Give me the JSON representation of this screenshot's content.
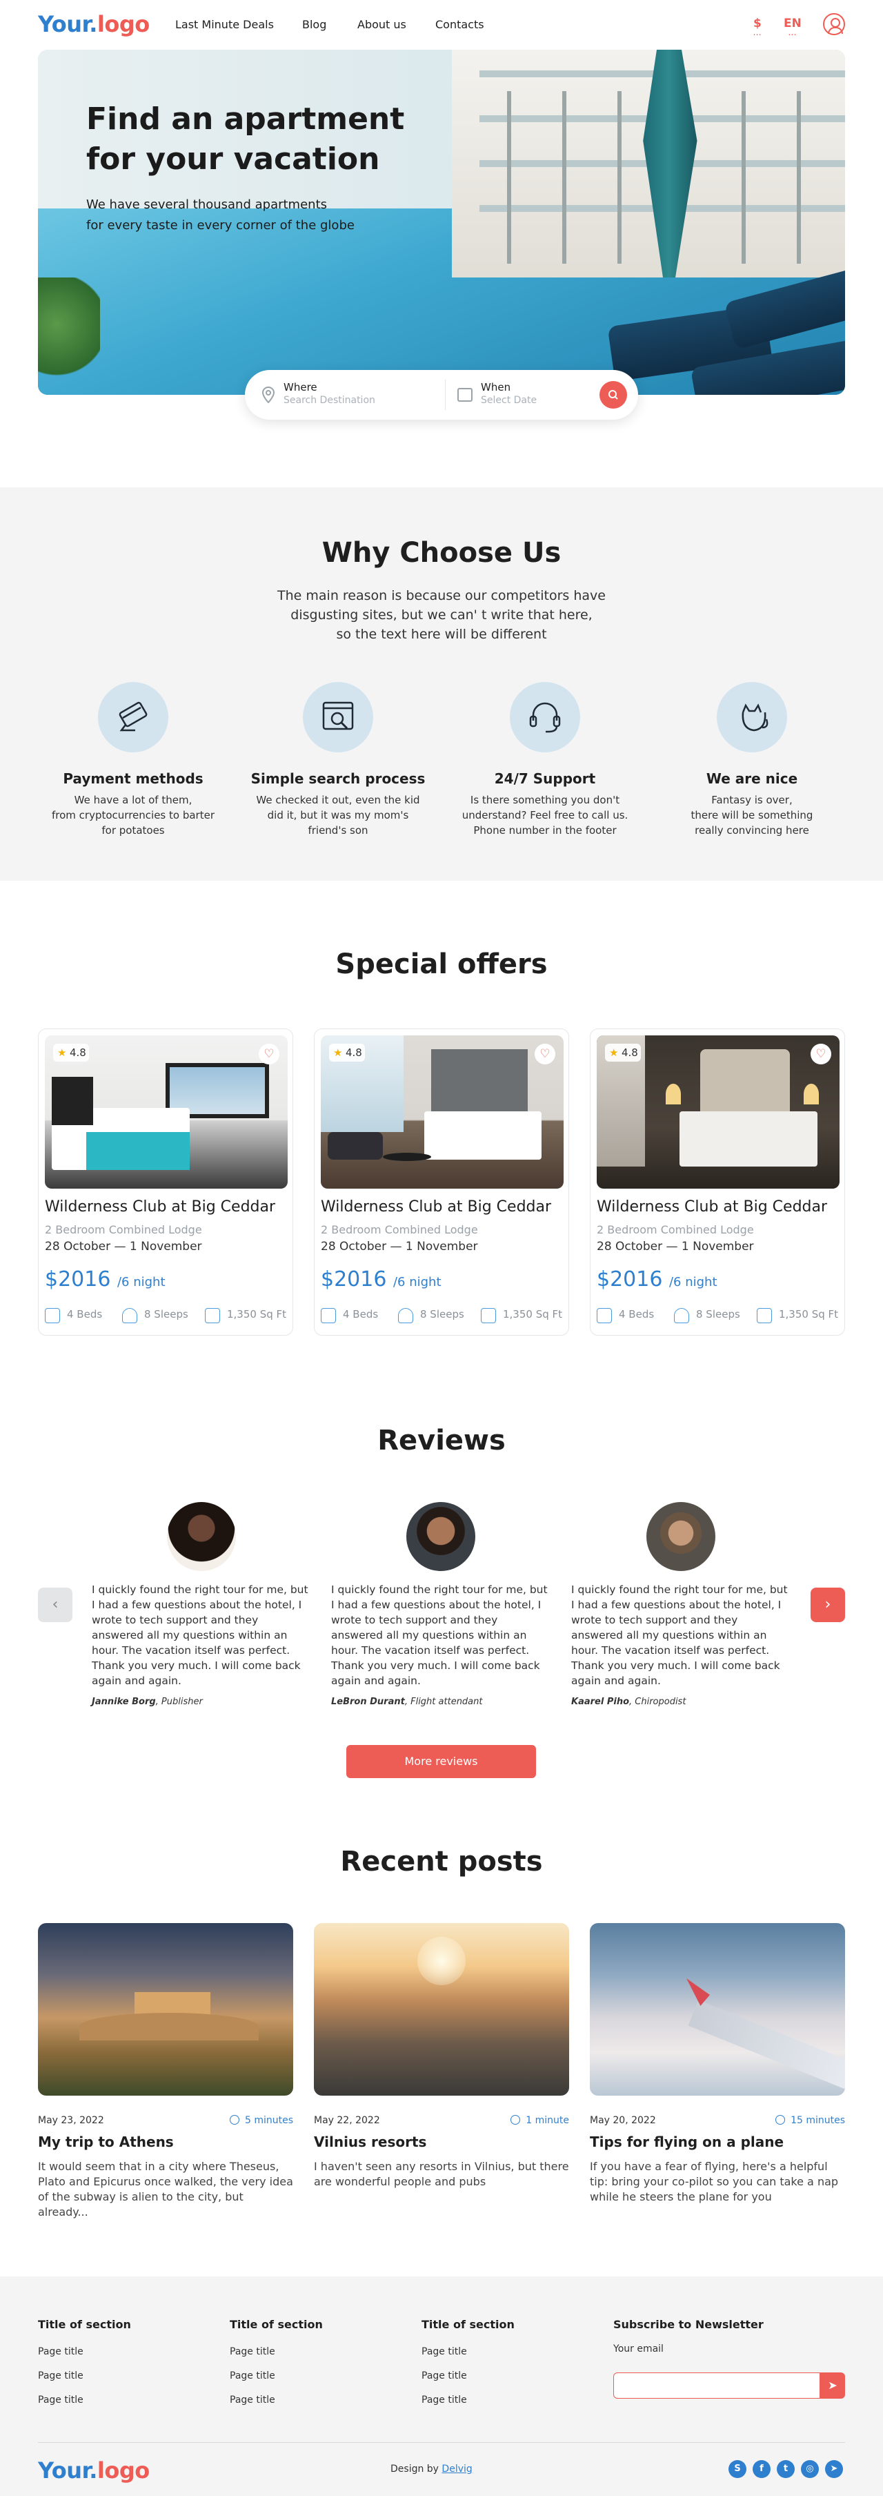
{
  "header": {
    "logo_left": "Your.",
    "logo_right": "logo",
    "nav": [
      "Last Minute Deals",
      "Blog",
      "About us",
      "Contacts"
    ],
    "currency": "$",
    "language": "EN"
  },
  "hero": {
    "title_line1": "Find an apartment",
    "title_line2": "for your vacation",
    "subtitle_line1": "We have several thousand apartments",
    "subtitle_line2": "for every taste in every corner of the globe"
  },
  "search": {
    "where_label": "Where",
    "where_placeholder": "Search Destination",
    "when_label": "When",
    "when_placeholder": "Select Date"
  },
  "why": {
    "title": "Why Choose Us",
    "subtitle_line1": "The main reason is because our competitors have",
    "subtitle_line2": "disgusting sites, but we can' t write that here,",
    "subtitle_line3": "so the text here will be different",
    "features": [
      {
        "title": "Payment methods",
        "l1": "We have a lot of them,",
        "l2": "from cryptocurrencies to barter",
        "l3": "for potatoes"
      },
      {
        "title": "Simple search process",
        "l1": "We checked it out, even the kid",
        "l2": "did it, but it was my mom's",
        "l3": "friend's son"
      },
      {
        "title": "24/7 Support",
        "l1": "Is there something you don't",
        "l2": "understand? Feel free to call us.",
        "l3": "Phone number in the footer"
      },
      {
        "title": "We are nice",
        "l1": "Fantasy is over,",
        "l2": "there will be something",
        "l3": "really convincing here"
      }
    ]
  },
  "offers": {
    "title": "Special offers",
    "cards": [
      {
        "rating": "4.8",
        "name": "Wilderness Club at Big Ceddar",
        "type": "2 Bedroom Combined Lodge",
        "dates": "28 October — 1 November",
        "price": "$2016",
        "per": "/6 night",
        "beds": "4 Beds",
        "sleeps": "8 Sleeps",
        "area": "1,350 Sq Ft"
      },
      {
        "rating": "4.8",
        "name": "Wilderness Club at Big Ceddar",
        "type": "2 Bedroom Combined Lodge",
        "dates": "28 October — 1 November",
        "price": "$2016",
        "per": "/6 night",
        "beds": "4 Beds",
        "sleeps": "8 Sleeps",
        "area": "1,350 Sq Ft"
      },
      {
        "rating": "4.8",
        "name": "Wilderness Club at Big Ceddar",
        "type": "2 Bedroom Combined Lodge",
        "dates": "28 October — 1 November",
        "price": "$2016",
        "per": "/6 night",
        "beds": "4 Beds",
        "sleeps": "8 Sleeps",
        "area": "1,350 Sq Ft"
      }
    ]
  },
  "reviews": {
    "title": "Reviews",
    "items": [
      {
        "text": "I quickly found the right tour for me, but I had a few questions about the hotel, I wrote to tech support and they answered all my questions within an hour. The vacation itself was perfect. Thank you very much. I will come back again and again.",
        "name": "Jannike Borg",
        "role": ", Publisher"
      },
      {
        "text": "I quickly found the right tour for me, but I had a few questions about the hotel, I wrote to tech support and they answered all my questions within an hour. The vacation itself was perfect. Thank you very much. I will come back again and again.",
        "name": "LeBron Durant",
        "role": ", Flight attendant"
      },
      {
        "text": "I quickly found the right tour for me, but I had a few questions about the hotel, I wrote to tech support and they answered all my questions within an hour. The vacation itself was perfect. Thank you very much. I will come back again and again.",
        "name": "Kaarel Piho",
        "role": ", Chiropodist"
      }
    ],
    "more_label": "More reviews"
  },
  "posts": {
    "title": "Recent posts",
    "items": [
      {
        "date": "May 23, 2022",
        "time": "5 minutes",
        "title": "My trip to Athens",
        "text": "It would seem that in a city where Theseus, Plato and Epicurus once walked, the very idea of the subway is alien to the city, but already..."
      },
      {
        "date": "May 22, 2022",
        "time": "1 minute",
        "title": "Vilnius resorts",
        "text": "I haven't seen any resorts in Vilnius, but there are wonderful people and pubs"
      },
      {
        "date": "May 20, 2022",
        "time": "15 minutes",
        "title": "Tips for flying on a plane",
        "text": "If you have a fear of flying, here's a helpful tip: bring your co-pilot so you can take a nap while he steers the plane for you"
      }
    ]
  },
  "footer": {
    "columns": [
      {
        "title": "Title of section",
        "items": [
          "Page title",
          "Page title",
          "Page title"
        ]
      },
      {
        "title": "Title of section",
        "items": [
          "Page title",
          "Page title",
          "Page title"
        ]
      },
      {
        "title": "Title of section",
        "items": [
          "Page title",
          "Page title",
          "Page title"
        ]
      }
    ],
    "newsletter_title": "Subscribe to Newsletter",
    "email_label": "Your email",
    "design_by": "Design by ",
    "design_link": "Delvig",
    "social_icons": [
      "skype-icon",
      "facebook-icon",
      "twitter-icon",
      "instagram-icon",
      "telegram-icon"
    ]
  }
}
